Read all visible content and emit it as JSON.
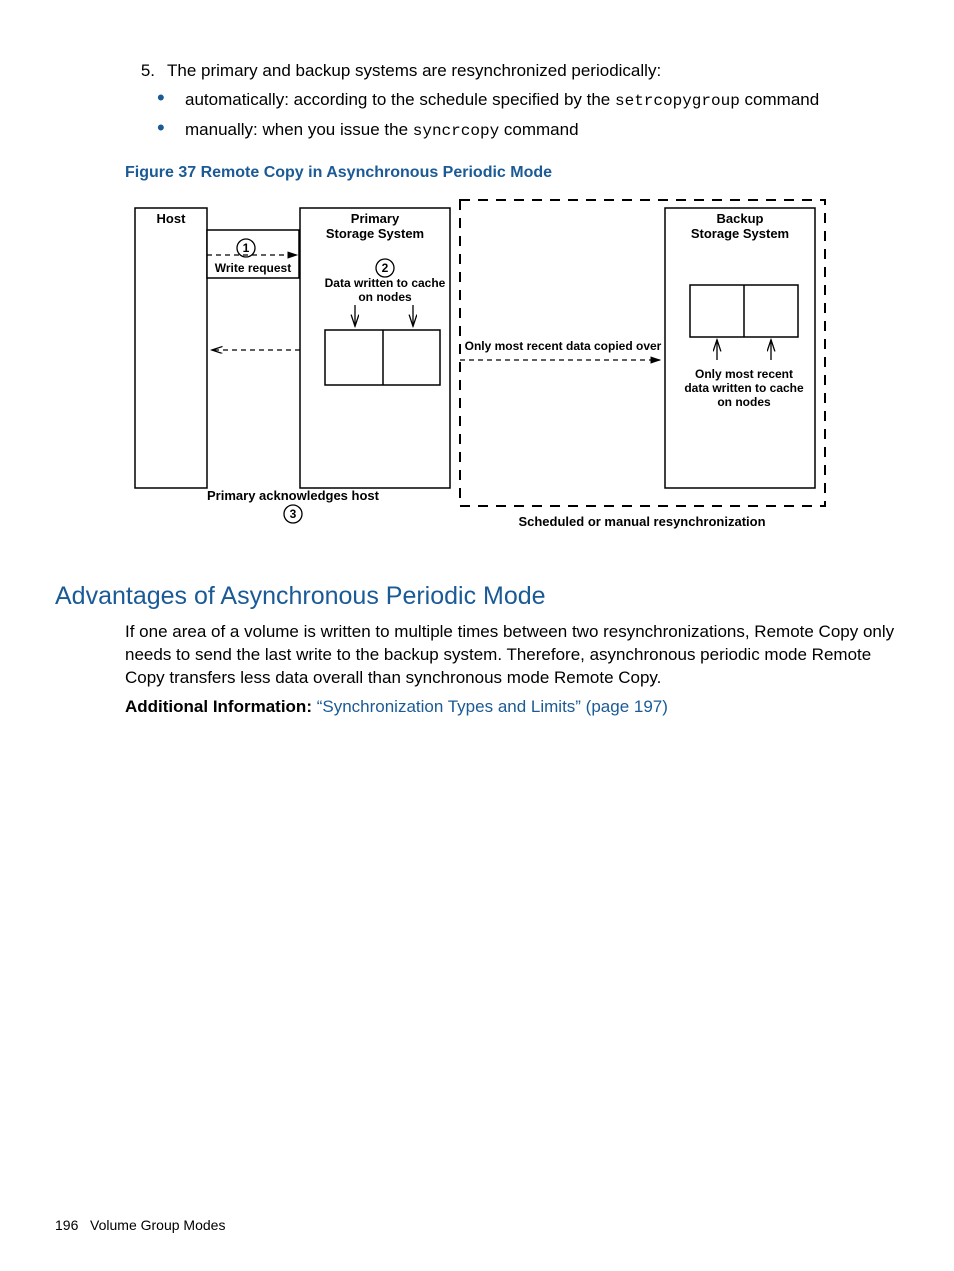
{
  "list": {
    "number": "5.",
    "text": "The primary and backup systems are resynchronized periodically:",
    "bullets": [
      {
        "pre": "automatically: according to the schedule specified by the ",
        "code": "setrcopygroup",
        "post": " command"
      },
      {
        "pre": "manually: when you issue the ",
        "code": "syncrcopy",
        "post": " command"
      }
    ]
  },
  "figure": {
    "caption": "Figure 37 Remote Copy in Asynchronous Periodic Mode",
    "labels": {
      "host": "Host",
      "primary": "Primary",
      "storageSystem": "Storage System",
      "backup": "Backup",
      "writeRequest": "Write request",
      "dataCache1": "Data written to cache",
      "dataCache2": "on nodes",
      "copied": "Only most recent data copied over",
      "recent1": "Only most recent",
      "recent2": "data written to cache",
      "recent3": "on nodes",
      "ack": "Primary acknowledges host",
      "sched": "Scheduled or manual resynchronization",
      "n1": "1",
      "n2": "2",
      "n3": "3"
    }
  },
  "section": {
    "heading": "Advantages of Asynchronous Periodic Mode",
    "body": "If one area of a volume is written to multiple times between two resynchronizations, Remote Copy only needs to send the last write to the backup system. Therefore, asynchronous periodic mode Remote Copy transfers less data overall than synchronous mode Remote Copy.",
    "addlLabel": "Additional Information: ",
    "addlLink": "“Synchronization Types and Limits” (page 197)"
  },
  "footer": {
    "pageNum": "196",
    "section": "Volume Group Modes"
  }
}
